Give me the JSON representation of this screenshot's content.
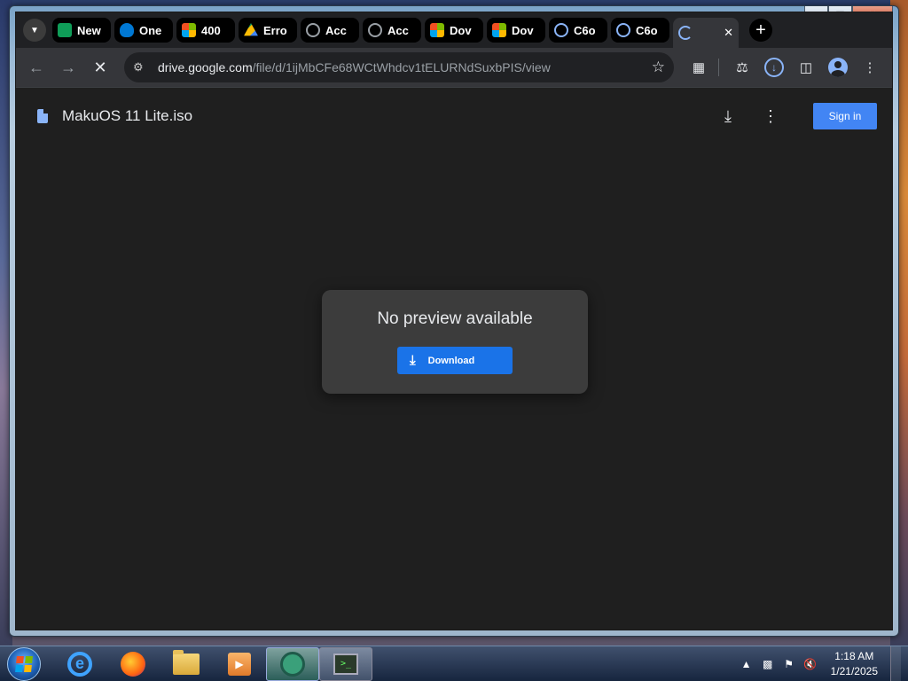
{
  "colors": {
    "accent": "#1a73e8",
    "signin_bg": "#4285f4",
    "page_bg": "#1f1f1f",
    "card_bg": "#3c3c3c"
  },
  "window": {
    "controls": {
      "minimize": "–",
      "maximize": "□",
      "close": "✕"
    }
  },
  "tabs": [
    {
      "label": "New",
      "icon": "google-sheets-icon",
      "color": "#0f9d58"
    },
    {
      "label": "One",
      "icon": "onedrive-icon",
      "color": "#0078d4"
    },
    {
      "label": "400",
      "icon": "microsoft-icon",
      "color": "#f25022"
    },
    {
      "label": "Erro",
      "icon": "google-drive-icon",
      "color": "#fbbc04"
    },
    {
      "label": "Acc",
      "icon": "globe-icon",
      "color": "#9aa0a6"
    },
    {
      "label": "Acc",
      "icon": "globe-icon",
      "color": "#9aa0a6"
    },
    {
      "label": "Dov",
      "icon": "microsoft-icon",
      "color": "#f25022"
    },
    {
      "label": "Dov",
      "icon": "microsoft-icon",
      "color": "#f25022"
    },
    {
      "label": "C6o",
      "icon": "gear-logo-icon",
      "color": "#8ab4f8"
    },
    {
      "label": "C6o",
      "icon": "gear-logo-icon",
      "color": "#8ab4f8"
    }
  ],
  "active_tab": {
    "icon": "loading-spinner-icon",
    "close": "✕"
  },
  "toolbar": {
    "url_host": "drive.google.com",
    "url_path": "/file/d/1ijMbCFe68WCtWhdcv1tELURNdSuxbPIS/view",
    "back": "←",
    "forward": "→",
    "stop": "✕",
    "star": "☆",
    "new_tab": "+"
  },
  "doc": {
    "title": "MakuOS 11 Lite.iso",
    "signin_label": "Sign in",
    "download_icon": "⤓",
    "more_icon": "⋮"
  },
  "preview": {
    "message": "No preview available",
    "download_label": "Download",
    "download_icon": "⤓"
  },
  "taskbar": {
    "time": "1:18 AM",
    "date": "1/21/2025",
    "tray_arrow": "▲",
    "ie_letter": "e",
    "media_glyph": "▶",
    "term_glyph": ">_"
  }
}
